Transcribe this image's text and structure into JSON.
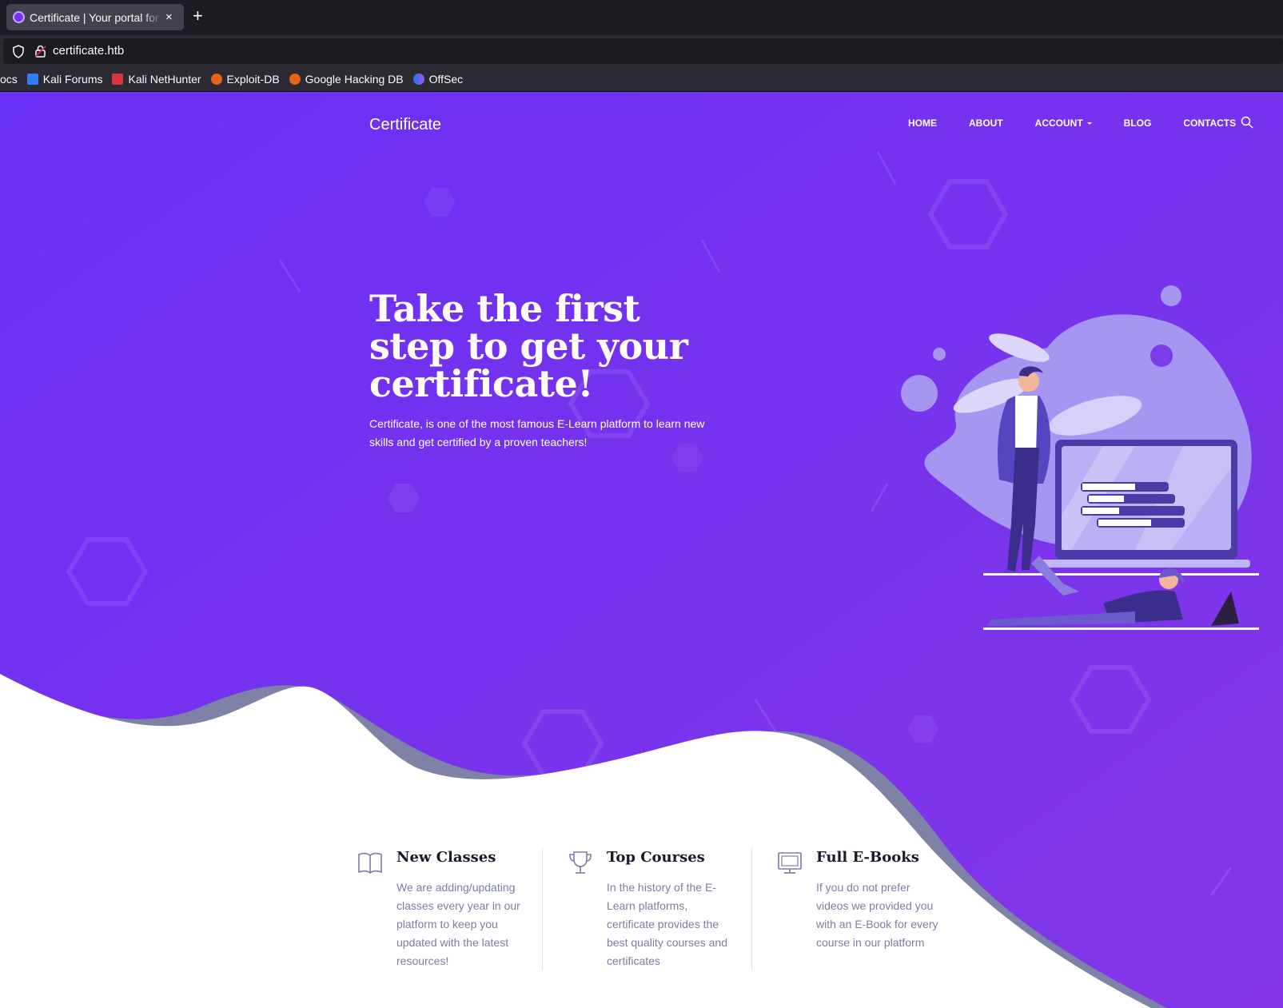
{
  "browser": {
    "tab_title": "Certificate | Your portal for certification",
    "tab_close": "×",
    "new_tab": "+",
    "url": "certificate.htb",
    "bookmarks": [
      {
        "label": "ocs"
      },
      {
        "label": "Kali Forums"
      },
      {
        "label": "Kali NetHunter"
      },
      {
        "label": "Exploit-DB"
      },
      {
        "label": "Google Hacking DB"
      },
      {
        "label": "OffSec"
      }
    ]
  },
  "site": {
    "brand": "Certificate",
    "nav": {
      "home": "HOME",
      "about": "ABOUT",
      "account": "ACCOUNT",
      "blog": "BLOG",
      "contacts": "CONTACTS"
    }
  },
  "hero": {
    "title": "Take the first step to get your certificate!",
    "text": "Certificate, is one of the most famous E-Learn platform to learn new skills and get certified by a proven teachers!"
  },
  "features": [
    {
      "icon": "book-icon",
      "title": "New Classes",
      "text": "We are adding/updating classes every year in our platform to keep you updated with the latest resources!"
    },
    {
      "icon": "trophy-icon",
      "title": "Top Courses",
      "text": "In the history of the E-Learn platforms, certificate provides the best quality courses and certificates"
    },
    {
      "icon": "monitor-icon",
      "title": "Full E-Books",
      "text": "If you do not prefer videos we provided you with an E-Book for every course in our platform"
    }
  ],
  "colors": {
    "hero_start": "#6a2ff5",
    "hero_end": "#8436e6",
    "wave_shadow": "#7d82a6",
    "illustration": "#a596f2"
  }
}
